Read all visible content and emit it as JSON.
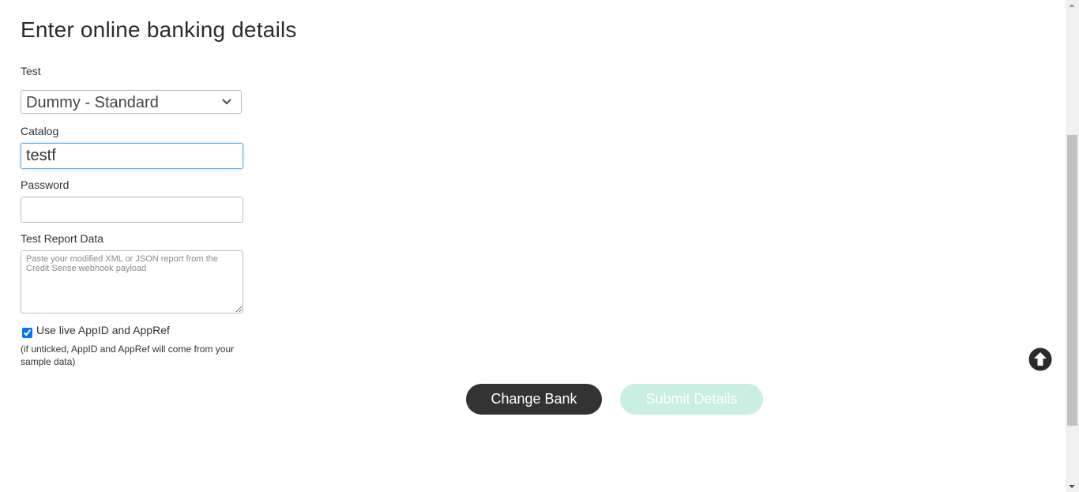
{
  "page": {
    "title": "Enter online banking details"
  },
  "form": {
    "test_label": "Test",
    "test_selected": "Dummy - Standard",
    "catalog_label": "Catalog",
    "catalog_value": "testf",
    "password_label": "Password",
    "password_value": "",
    "report_label": "Test Report Data",
    "report_placeholder": "Paste your modified XML or JSON report from the Credit Sense webhook payload",
    "live_checkbox_label": "Use live AppID and AppRef",
    "live_checkbox_checked": true,
    "hint": "(if unticked, AppID and AppRef will come from your sample data)"
  },
  "buttons": {
    "change_bank": "Change Bank",
    "submit_details": "Submit Details"
  },
  "colors": {
    "primary_dark": "#333333",
    "submit_disabled": "#c9efe2",
    "focus_border": "#66afe9"
  },
  "icons": {
    "dropdown": "chevron-down-icon",
    "scroll_top": "arrow-up-circle-icon"
  }
}
